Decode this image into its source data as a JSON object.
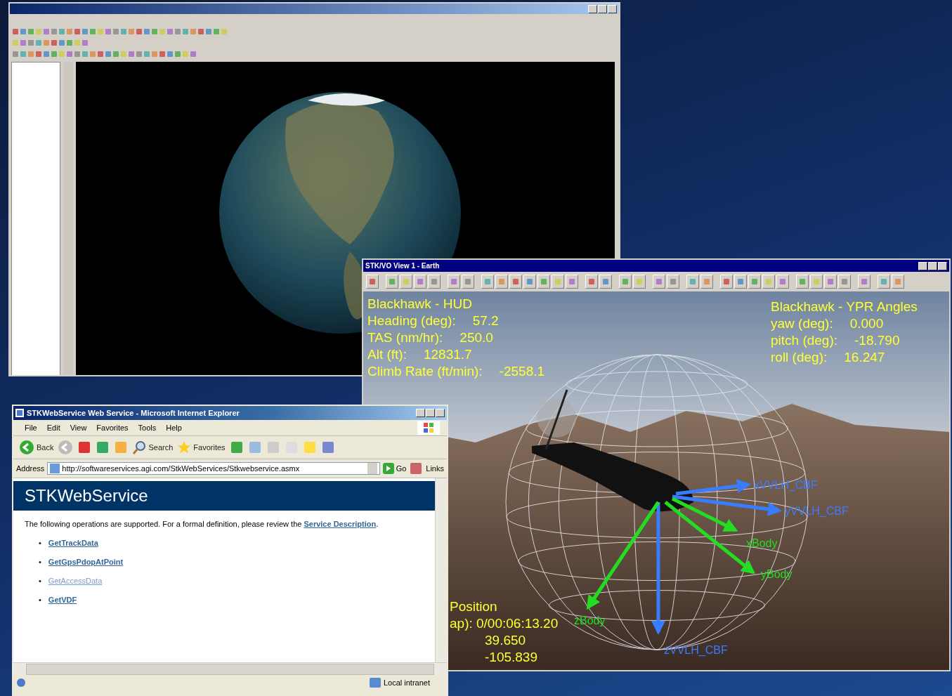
{
  "vo_window": {
    "title": "STK/VO View 1 - Earth",
    "hud": {
      "title": "Blackhawk - HUD",
      "rows": [
        {
          "label": "Heading (deg):",
          "value": "57.2"
        },
        {
          "label": "TAS (nm/hr):",
          "value": "250.0"
        },
        {
          "label": "Alt (ft):",
          "value": "12831.7"
        },
        {
          "label": "Climb Rate (ft/min):",
          "value": "-2558.1"
        }
      ]
    },
    "ypr": {
      "title": "Blackhawk - YPR Angles",
      "rows": [
        {
          "label": "yaw (deg):",
          "value": "0.000"
        },
        {
          "label": "pitch (deg):",
          "value": "-18.790"
        },
        {
          "label": "roll (deg):",
          "value": "16.247"
        }
      ]
    },
    "position": {
      "title": "Position",
      "lines": [
        "ap): 0/00:06:13.20",
        "39.650",
        "-105.839"
      ]
    },
    "axes": [
      {
        "label": "xVVLH_CBF",
        "kind": "vvlh"
      },
      {
        "label": "yVVLH_CBF",
        "kind": "vvlh"
      },
      {
        "label": "zVVLH_CBF",
        "kind": "vvlh"
      },
      {
        "label": "xBody",
        "kind": "body"
      },
      {
        "label": "yBody",
        "kind": "body"
      },
      {
        "label": "zBody",
        "kind": "body"
      }
    ]
  },
  "ie_window": {
    "title": "STKWebService Web Service - Microsoft Internet Explorer",
    "menu": [
      "File",
      "Edit",
      "View",
      "Favorites",
      "Tools",
      "Help"
    ],
    "back_label": "Back",
    "search_label": "Search",
    "favorites_label": "Favorites",
    "address_label": "Address",
    "url": "http://softwareservices.agi.com/StkWebServices/Stkwebservice.asmx",
    "go_label": "Go",
    "links_label": "Links",
    "page": {
      "heading": "STKWebService",
      "intro": "The following operations are supported. For a formal definition, please review the ",
      "intro_link": "Service Description",
      "intro_end": ".",
      "operations": [
        {
          "marker": "•",
          "name": "GetTrackData",
          "visited": false
        },
        {
          "marker": "•",
          "name": "GetGpsPdopAtPoint",
          "visited": false
        },
        {
          "marker": "•",
          "name": "GetAccessData",
          "visited": true
        },
        {
          "marker": "•",
          "name": "GetVDF",
          "visited": false
        }
      ]
    },
    "status": "Local intranet"
  }
}
